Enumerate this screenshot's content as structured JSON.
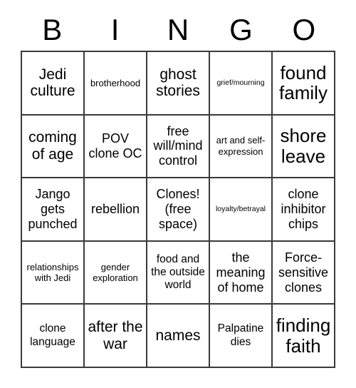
{
  "card": {
    "title": "BINGO",
    "header_letters": [
      "B",
      "I",
      "N",
      "G",
      "O"
    ],
    "grid_size": "5x5",
    "free_space_index": 12,
    "colors": {
      "background": "#ffffff",
      "text": "#000000",
      "grid_line": "#3a3a3a"
    },
    "cells": [
      {
        "text": "Jedi culture",
        "size": "xl"
      },
      {
        "text": "brotherhood",
        "size": "sm"
      },
      {
        "text": "ghost stories",
        "size": "xl"
      },
      {
        "text": "grief/mourning",
        "size": "xs"
      },
      {
        "text": "found family",
        "size": "xxl"
      },
      {
        "text": "coming of age",
        "size": "xl"
      },
      {
        "text": "POV clone OC",
        "size": "lg"
      },
      {
        "text": "free will/mind control",
        "size": "lg"
      },
      {
        "text": "art and self-expression",
        "size": "sm"
      },
      {
        "text": "shore leave",
        "size": "xxl"
      },
      {
        "text": "Jango gets punched",
        "size": "lg"
      },
      {
        "text": "rebellion",
        "size": "lg"
      },
      {
        "text": "Clones! (free space)",
        "size": "lg"
      },
      {
        "text": "loyalty/betrayal",
        "size": "xs"
      },
      {
        "text": "clone inhibitor chips",
        "size": "lg"
      },
      {
        "text": "relationships with Jedi",
        "size": "sm"
      },
      {
        "text": "gender exploration",
        "size": "sm"
      },
      {
        "text": "food and the outside world",
        "size": "md"
      },
      {
        "text": "the meaning of home",
        "size": "lg"
      },
      {
        "text": "Force-sensitive clones",
        "size": "lg"
      },
      {
        "text": "clone language",
        "size": "md"
      },
      {
        "text": "after the war",
        "size": "xl"
      },
      {
        "text": "names",
        "size": "xl"
      },
      {
        "text": "Palpatine dies",
        "size": "md"
      },
      {
        "text": "finding faith",
        "size": "xxl"
      }
    ]
  }
}
